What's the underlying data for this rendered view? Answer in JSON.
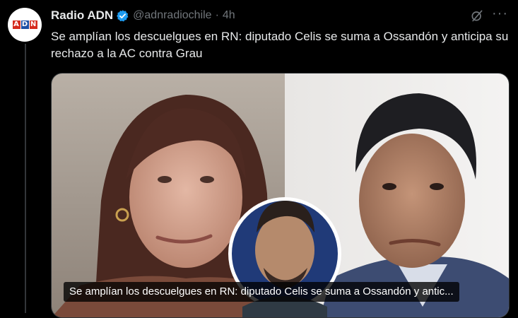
{
  "tweet": {
    "display_name": "Radio ADN",
    "handle": "@adnradiochile",
    "separator": "·",
    "timestamp": "4h",
    "text": "Se amplían los descuelgues en RN: diputado Celis se suma a Ossandón y anticipa su rechazo a la AC contra Grau",
    "media_caption": "Se amplían los descuelgues en RN: diputado Celis se suma a Ossandón y antic...",
    "more_label": "···"
  },
  "avatar": {
    "logo_letters": [
      "A",
      "D",
      "N"
    ],
    "logo_colors": [
      "#d52b1e",
      "#1d4fa5",
      "#d52b1e"
    ]
  },
  "icons": {
    "verified": "verified-badge-icon",
    "grok": "grok-icon",
    "more": "more-icon"
  },
  "colors": {
    "background": "#000000",
    "text_primary": "#e7e9ea",
    "text_secondary": "#71767b",
    "verified_blue": "#1d9bf0"
  }
}
